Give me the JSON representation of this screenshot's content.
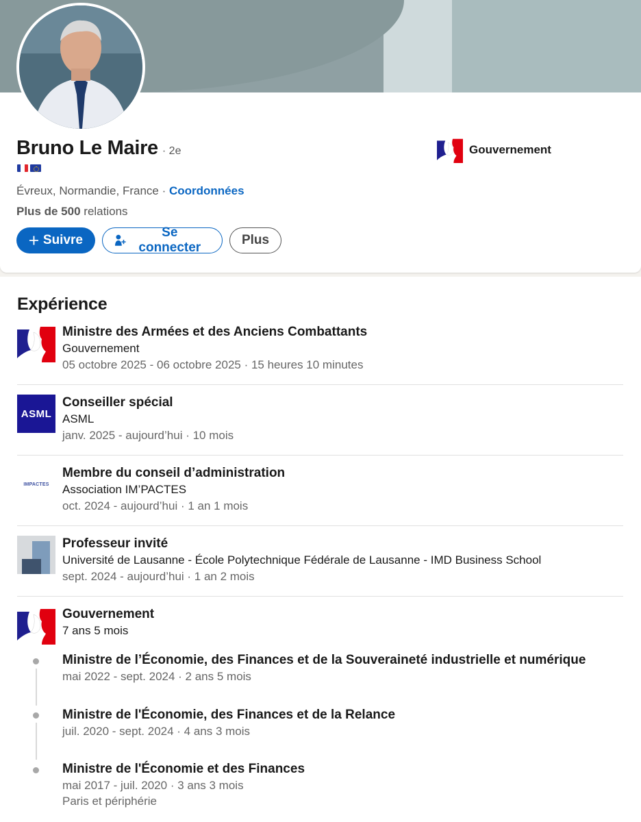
{
  "profile": {
    "name": "Bruno Le Maire",
    "degree": "· 2e",
    "location": "Évreux, Normandie, France",
    "separator": " · ",
    "contact_link": "Coordonnées",
    "relations_bold": "Plus de 500",
    "relations_rest": " relations",
    "company": "Gouvernement",
    "flags": [
      "france-flag",
      "eu-flag"
    ]
  },
  "actions": {
    "follow_label": "Suivre",
    "connect_label": "Se connecter",
    "more_label": "Plus",
    "accent": "#0a66c2"
  },
  "experience": {
    "heading": "Expérience",
    "items": [
      {
        "title": "Ministre des Armées et des Anciens Combattants",
        "org": "Gouvernement",
        "dates": "05 octobre 2025 - 06 octobre 2025 · 15 heures 10 minutes",
        "logo": "gouvernement-logo"
      },
      {
        "title": "Conseiller spécial",
        "org": "ASML",
        "dates": "janv. 2025 - aujourd’hui · 10 mois",
        "logo": "asml-logo",
        "logo_text": "ASML"
      },
      {
        "title": "Membre du conseil d’administration",
        "org": "Association IM’PACTES",
        "dates": "oct. 2024 - aujourd’hui · 1 an 1 mois",
        "logo": "impactes-logo",
        "logo_text": "IMPACTES"
      },
      {
        "title": "Professeur invité",
        "org": "Université de Lausanne - École Polytechnique Fédérale de Lausanne - IMD Business School",
        "dates": "sept. 2024 - aujourd’hui · 1 an 2 mois",
        "logo": "university-logo"
      }
    ],
    "group": {
      "org": "Gouvernement",
      "duration": "7 ans 5 mois",
      "logo": "gouvernement-logo",
      "roles": [
        {
          "title": "Ministre de l’Économie, des Finances et de la Souveraineté industrielle et numérique",
          "dates": "mai 2022 - sept. 2024 · 2 ans 5 mois"
        },
        {
          "title": "Ministre de l'Économie, des Finances et de la Relance",
          "dates": "juil. 2020 - sept. 2024 · 4 ans 3 mois"
        },
        {
          "title": "Ministre de l'Économie et des Finances",
          "dates": "mai 2017 - juil. 2020 · 3 ans 3 mois",
          "location": "Paris et périphérie"
        }
      ]
    }
  }
}
